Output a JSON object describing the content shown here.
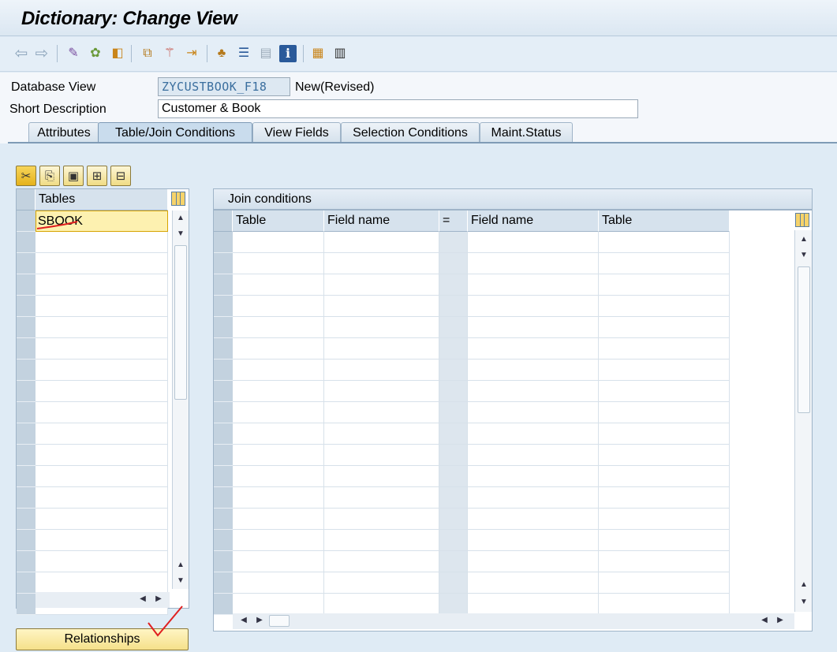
{
  "window": {
    "title": "Dictionary: Change View"
  },
  "toolbar": {
    "icons": [
      "back-arrow-icon",
      "forward-arrow-icon",
      "display-change-icon",
      "activate-icon",
      "check-icon",
      "where-used-icon",
      "magic-wand-icon",
      "navigate-icon",
      "hierarchy-icon",
      "stack-icon",
      "table-view-icon",
      "info-icon",
      "layout-icon",
      "columns-icon"
    ]
  },
  "header": {
    "db_view_label": "Database View",
    "db_view_value": "ZYCUSTBOOK_F18",
    "db_view_status": "New(Revised)",
    "short_desc_label": "Short Description",
    "short_desc_value": "Customer & Book"
  },
  "tabs": [
    {
      "label": "Attributes",
      "active": false
    },
    {
      "label": "Table/Join Conditions",
      "active": true
    },
    {
      "label": "View Fields",
      "active": false
    },
    {
      "label": "Selection Conditions",
      "active": false
    },
    {
      "label": "Maint.Status",
      "active": false
    }
  ],
  "tables_grid": {
    "header": "Tables",
    "rows": [
      "SBOOK",
      "",
      "",
      "",
      "",
      "",
      "",
      "",
      "",
      "",
      "",
      "",
      "",
      "",
      "",
      "",
      "",
      "",
      ""
    ]
  },
  "join_grid": {
    "title": "Join conditions",
    "columns": [
      "Table",
      "Field name",
      "=",
      "Field name",
      "Table"
    ],
    "row_count": 18
  },
  "relationships_button": {
    "label": "Relationships"
  },
  "colors": {
    "accent": "#f0dc84",
    "annotation": "#e02020"
  }
}
